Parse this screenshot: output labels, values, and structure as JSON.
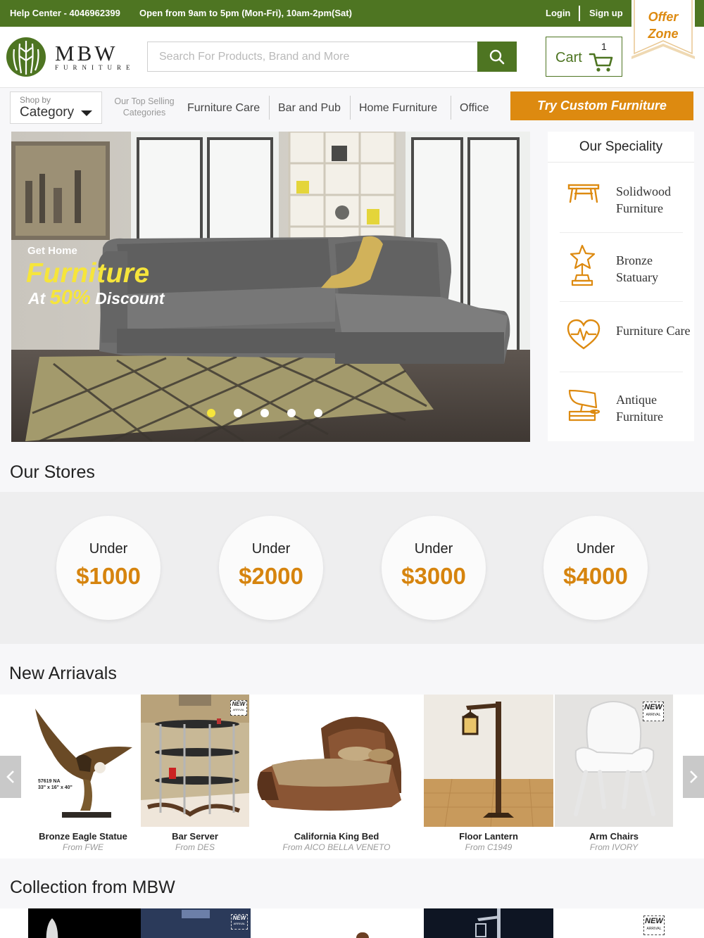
{
  "topbar": {
    "help": "Help Center - 4046962399",
    "hours": "Open from 9am to 5pm (Mon-Fri), 10am-2pm(Sat)",
    "login": "Login",
    "signup": "Sign up"
  },
  "offer": {
    "line1": "Offer",
    "line2": "Zone"
  },
  "brand": {
    "name": "MBW",
    "sub": "FURNITURE"
  },
  "search": {
    "placeholder": "Search For Products, Brand and More",
    "value": ""
  },
  "cart": {
    "label": "Cart",
    "count": "1"
  },
  "nav": {
    "shop_by": "Shop by",
    "category": "Category",
    "top_selling": "Our Top Selling Categories",
    "links": [
      "Furniture Care",
      "Bar and Pub",
      "Home Furniture",
      "Office"
    ],
    "cta": "Try Custom Furniture"
  },
  "hero": {
    "get_home": "Get Home",
    "headline": "Furniture",
    "at": "At",
    "percent": "50%",
    "discount": "Discount",
    "slides": 5,
    "active_slide": 1
  },
  "speciality": {
    "title": "Our Speciality",
    "items": [
      {
        "label": "Solidwood Furniture",
        "icon": "table-icon"
      },
      {
        "label": "Bronze Statuary",
        "icon": "trophy-icon"
      },
      {
        "label": "Furniture Care",
        "icon": "heart-pulse-icon"
      },
      {
        "label": "Antique Furniture",
        "icon": "gramophone-icon"
      }
    ]
  },
  "stores": {
    "title": "Our Stores",
    "items": [
      {
        "under": "Under",
        "price": "$1000"
      },
      {
        "under": "Under",
        "price": "$2000"
      },
      {
        "under": "Under",
        "price": "$3000"
      },
      {
        "under": "Under",
        "price": "$4000"
      }
    ]
  },
  "arrivals": {
    "title": "New Arriavals",
    "items": [
      {
        "name": "Bronze Eagle Statue",
        "from": "From FWE",
        "caption": "57619 NA",
        "caption2": "33\" x 16\" x 40\""
      },
      {
        "name": "Bar Server",
        "from": "From DES"
      },
      {
        "name": "California King Bed",
        "from": "From AICO BELLA VENETO"
      },
      {
        "name": "Floor Lantern",
        "from": "From C1949"
      },
      {
        "name": "Arm Chairs",
        "from": "From IVORY"
      }
    ],
    "badge": "NEW",
    "badge_sub": "ARRIVAL"
  },
  "collection": {
    "title": "Collection from MBW"
  },
  "colors": {
    "green": "#4e7522",
    "orange": "#dd8a10",
    "price": "#d6840e",
    "yellow": "#f6e53b"
  }
}
